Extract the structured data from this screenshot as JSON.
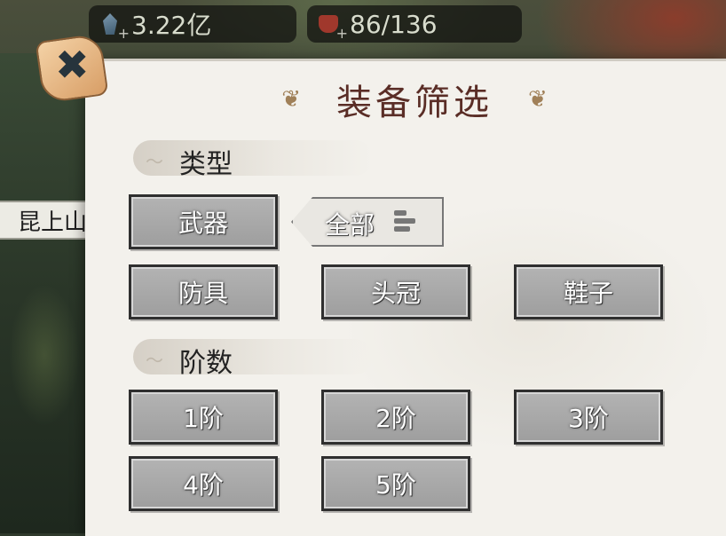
{
  "resources": {
    "gem": {
      "value": "3.22亿",
      "icon": "gem-icon"
    },
    "stamina": {
      "value": "86/136",
      "icon": "stamina-icon"
    }
  },
  "side_label": "昆上山",
  "panel": {
    "title": "装备筛选",
    "close_icon": "close-icon",
    "type_section": {
      "header": "类型",
      "options": [
        "武器",
        "防具",
        "头冠",
        "鞋子"
      ],
      "selector": {
        "label": "全部",
        "icon": "list-icon"
      }
    },
    "tier_section": {
      "header": "阶数",
      "options": [
        "1阶",
        "2阶",
        "3阶",
        "4阶",
        "5阶"
      ]
    }
  }
}
